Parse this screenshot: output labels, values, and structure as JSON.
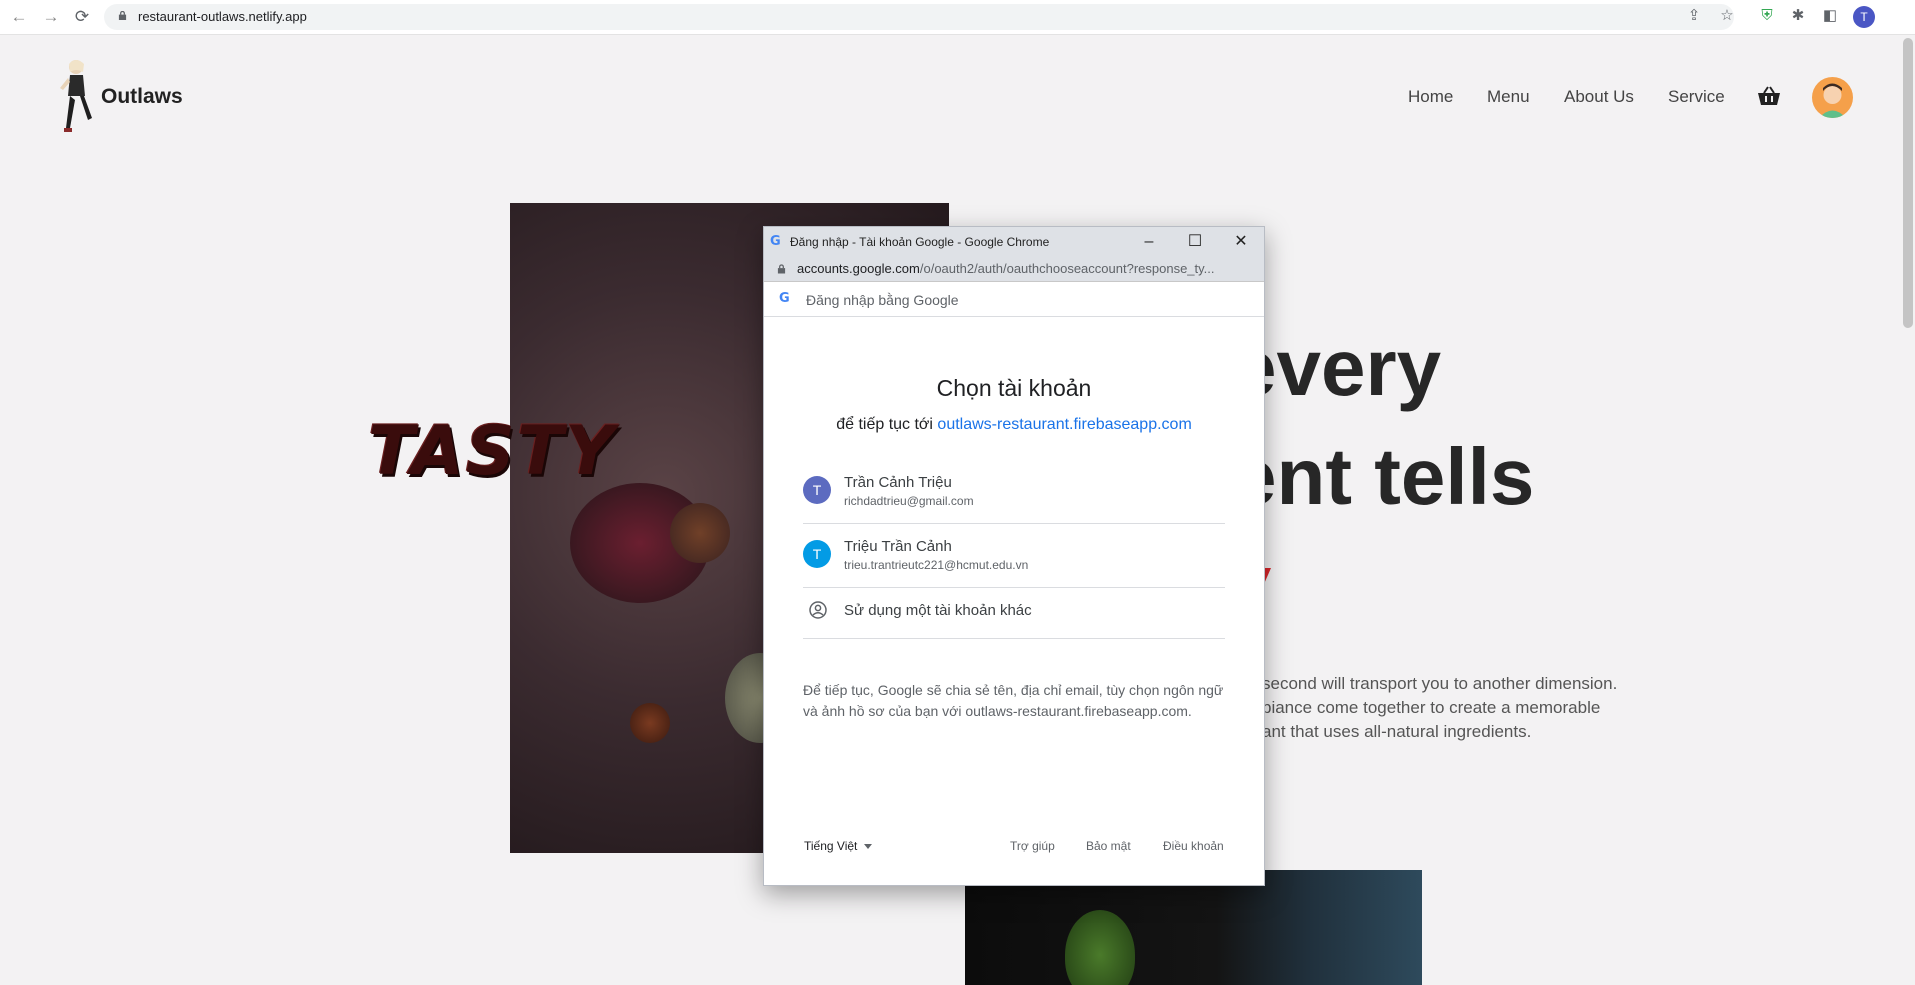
{
  "browser": {
    "url": "restaurant-outlaws.netlify.app",
    "profile_initial": "T"
  },
  "site": {
    "brand": "Outlaws",
    "nav": [
      "Home",
      "Menu",
      "About Us",
      "Service"
    ],
    "tasty": "TASTY",
    "headline_line1": "every",
    "headline_line2": "ent tells",
    "paragraph": [
      "second will transport you to another dimension.",
      "biance come together to create a memorable",
      "ant that uses all-natural ingredients."
    ]
  },
  "popup": {
    "window_title": "Đăng nhập - Tài khoản Google - Google Chrome",
    "url_host": "accounts.google.com",
    "url_rest": "/o/oauth2/auth/oauthchooseaccount?response_ty...",
    "header": "Đăng nhập bằng Google",
    "title": "Chọn tài khoản",
    "subtitle_prefix": "để tiếp tục tới ",
    "subtitle_link": "outlaws-restaurant.firebaseapp.com",
    "accounts": [
      {
        "initial": "T",
        "name": "Trần Cảnh Triệu",
        "email": "richdadtrieu@gmail.com",
        "color": "#5c6bc0"
      },
      {
        "initial": "T",
        "name": "Triệu Trần Cảnh",
        "email": "trieu.trantrieutc221@hcmut.edu.vn",
        "color": "#039be5"
      }
    ],
    "other_account": "Sử dụng một tài khoản khác",
    "disclaimer": "Để tiếp tục, Google sẽ chia sẻ tên, địa chỉ email, tùy chọn ngôn ngữ và ảnh hồ sơ của bạn với outlaws-restaurant.firebaseapp.com.",
    "language": "Tiếng Việt",
    "footer_links": [
      "Trợ giúp",
      "Bảo mật",
      "Điều khoản"
    ]
  }
}
